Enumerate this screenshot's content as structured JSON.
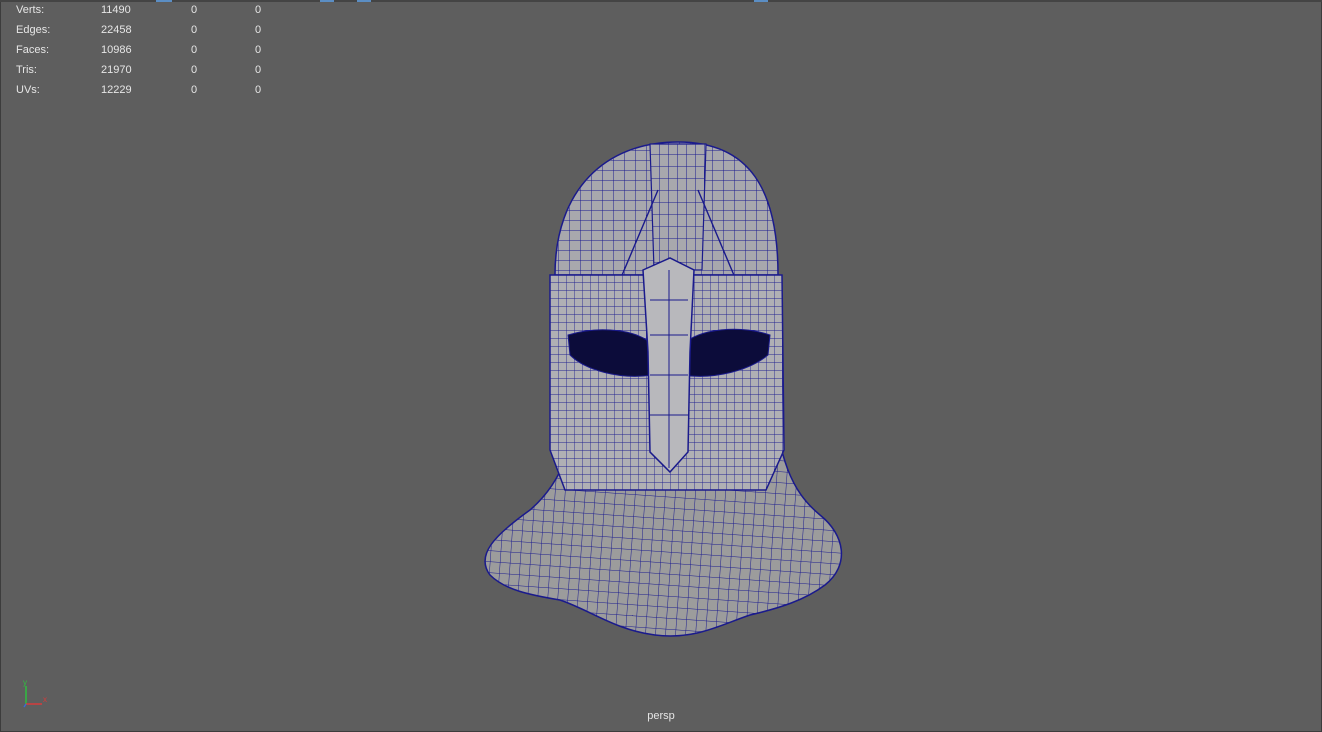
{
  "viewport": {
    "camera_label": "persp",
    "background_color": "#5e5e5e",
    "wireframe_color": "#1a1a8c"
  },
  "hud": {
    "rows": [
      {
        "label": "Verts:",
        "total": "11490",
        "selected": "0",
        "component": "0"
      },
      {
        "label": "Edges:",
        "total": "22458",
        "selected": "0",
        "component": "0"
      },
      {
        "label": "Faces:",
        "total": "10986",
        "selected": "0",
        "component": "0"
      },
      {
        "label": "Tris:",
        "total": "21970",
        "selected": "0",
        "component": "0"
      },
      {
        "label": "UVs:",
        "total": "12229",
        "selected": "0",
        "component": "0"
      }
    ]
  },
  "axis_gizmo": {
    "y_label": "y",
    "x_label": "x"
  },
  "model": {
    "icon": "helmet-wireframe-mesh"
  }
}
